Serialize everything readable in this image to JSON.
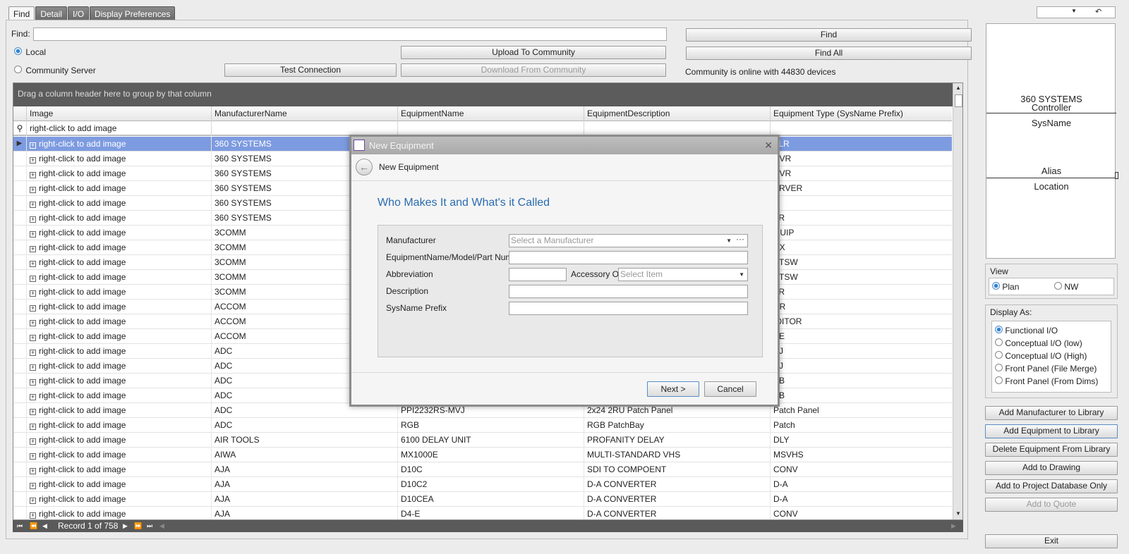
{
  "tabs": [
    "Find",
    "Detail",
    "I/O",
    "Display Preferences"
  ],
  "find": {
    "label": "Find:",
    "value": "",
    "local_label": "Local",
    "community_label": "Community Server",
    "upload_button": "Upload To Community",
    "test_button": "Test Connection",
    "download_button": "Download From Community",
    "find_button": "Find",
    "find_all_button": "Find All",
    "status": "Community is online with 44830 devices"
  },
  "grid": {
    "group_hint": "Drag a column header here to group by that column",
    "columns": [
      "Image",
      "ManufacturerName",
      "EquipmentName",
      "EquipmentDescription",
      "Equipment Type (SysName Prefix)"
    ],
    "filter_text": "right-click to add image",
    "rows": [
      {
        "image": "right-click to add image",
        "mfr": "360 SYSTEMS",
        "name": "",
        "desc": "",
        "type": "TLR"
      },
      {
        "image": "right-click to add image",
        "mfr": "360 SYSTEMS",
        "name": "",
        "desc": "",
        "type": "RVR"
      },
      {
        "image": "right-click to add image",
        "mfr": "360 SYSTEMS",
        "name": "",
        "desc": "",
        "type": "RVR"
      },
      {
        "image": "right-click to add image",
        "mfr": "360 SYSTEMS",
        "name": "",
        "desc": "",
        "type": "ERVER"
      },
      {
        "image": "right-click to add image",
        "mfr": "360 SYSTEMS",
        "name": "",
        "desc": "",
        "type": ""
      },
      {
        "image": "right-click to add image",
        "mfr": "360 SYSTEMS",
        "name": "",
        "desc": "",
        "type": "TR"
      },
      {
        "image": "right-click to add image",
        "mfr": "3COMM",
        "name": "",
        "desc": "",
        "type": "QUIP"
      },
      {
        "image": "right-click to add image",
        "mfr": "3COMM",
        "name": "",
        "desc": "",
        "type": "DX"
      },
      {
        "image": "right-click to add image",
        "mfr": "3COMM",
        "name": "",
        "desc": "",
        "type": "ETSW"
      },
      {
        "image": "right-click to add image",
        "mfr": "3COMM",
        "name": "",
        "desc": "",
        "type": "ETSW"
      },
      {
        "image": "right-click to add image",
        "mfr": "3COMM",
        "name": "",
        "desc": "",
        "type": "TR"
      },
      {
        "image": "right-click to add image",
        "mfr": "ACCOM",
        "name": "",
        "desc": "",
        "type": "DR"
      },
      {
        "image": "right-click to add image",
        "mfr": "ACCOM",
        "name": "",
        "desc": "",
        "type": "IDITOR"
      },
      {
        "image": "right-click to add image",
        "mfr": "ACCOM",
        "name": "",
        "desc": "",
        "type": "VE"
      },
      {
        "image": "right-click to add image",
        "mfr": "ADC",
        "name": "",
        "desc": "",
        "type": "VJ"
      },
      {
        "image": "right-click to add image",
        "mfr": "ADC",
        "name": "",
        "desc": "",
        "type": "AJ"
      },
      {
        "image": "right-click to add image",
        "mfr": "ADC",
        "name": "",
        "desc": "",
        "type": "VB"
      },
      {
        "image": "right-click to add image",
        "mfr": "ADC",
        "name": "",
        "desc": "",
        "type": "VB"
      },
      {
        "image": "right-click to add image",
        "mfr": "ADC",
        "name": "PPI2232RS-MVJ",
        "desc": "2x24 2RU Patch Panel",
        "type": "Patch Panel"
      },
      {
        "image": "right-click to add image",
        "mfr": "ADC",
        "name": "RGB",
        "desc": "RGB PatchBay",
        "type": "Patch"
      },
      {
        "image": "right-click to add image",
        "mfr": "AIR TOOLS",
        "name": "6100 DELAY UNIT",
        "desc": "PROFANITY DELAY",
        "type": "DLY"
      },
      {
        "image": "right-click to add image",
        "mfr": "AIWA",
        "name": "MX1000E",
        "desc": "MULTI-STANDARD VHS",
        "type": "MSVHS"
      },
      {
        "image": "right-click to add image",
        "mfr": "AJA",
        "name": "D10C",
        "desc": "SDI TO COMPOENT",
        "type": "CONV"
      },
      {
        "image": "right-click to add image",
        "mfr": "AJA",
        "name": "D10C2",
        "desc": "D-A CONVERTER",
        "type": "D-A"
      },
      {
        "image": "right-click to add image",
        "mfr": "AJA",
        "name": "D10CEA",
        "desc": "D-A CONVERTER",
        "type": "D-A"
      },
      {
        "image": "right-click to add image",
        "mfr": "AJA",
        "name": "D4-E",
        "desc": "D-A CONVERTER",
        "type": "CONV"
      }
    ],
    "record_text": "Record 1 of 758"
  },
  "preview": {
    "manufacturer": "360 SYSTEMS",
    "type": "Controller",
    "sysname": "SysName",
    "alias": "Alias",
    "location": "Location"
  },
  "view": {
    "title": "View",
    "plan": "Plan",
    "nw": "NW"
  },
  "display_as": {
    "title": "Display As:",
    "options": [
      "Functional I/O",
      "Conceptual I/O (low)",
      "Conceptual I/O (High)",
      "Front Panel (File Merge)",
      "Front Panel (From Dims)"
    ]
  },
  "actions": {
    "add_manufacturer": "Add Manufacturer to Library",
    "add_equipment": "Add Equipment to Library",
    "delete_equipment": "Delete Equipment From Library",
    "add_drawing": "Add to Drawing",
    "add_project": "Add to Project Database Only",
    "add_quote": "Add to Quote",
    "exit": "Exit"
  },
  "dialog": {
    "title": "New Equipment",
    "subtitle": "New Equipment",
    "heading": "Who Makes It and What's it Called",
    "manufacturer_label": "Manufacturer",
    "manufacturer_placeholder": "Select a Manufacturer",
    "equipment_label": "EquipmentName/Model/Part Number",
    "abbreviation_label": "Abbreviation",
    "accessory_label": "Accessory Of",
    "accessory_placeholder": "Select Item",
    "description_label": "Description",
    "sysname_label": "SysName Prefix",
    "next_button": "Next >",
    "cancel_button": "Cancel"
  },
  "colors": {
    "selection": "#7d9be0",
    "heading_blue": "#2b6cb0",
    "grid_header_dark": "#5c5c5c"
  }
}
